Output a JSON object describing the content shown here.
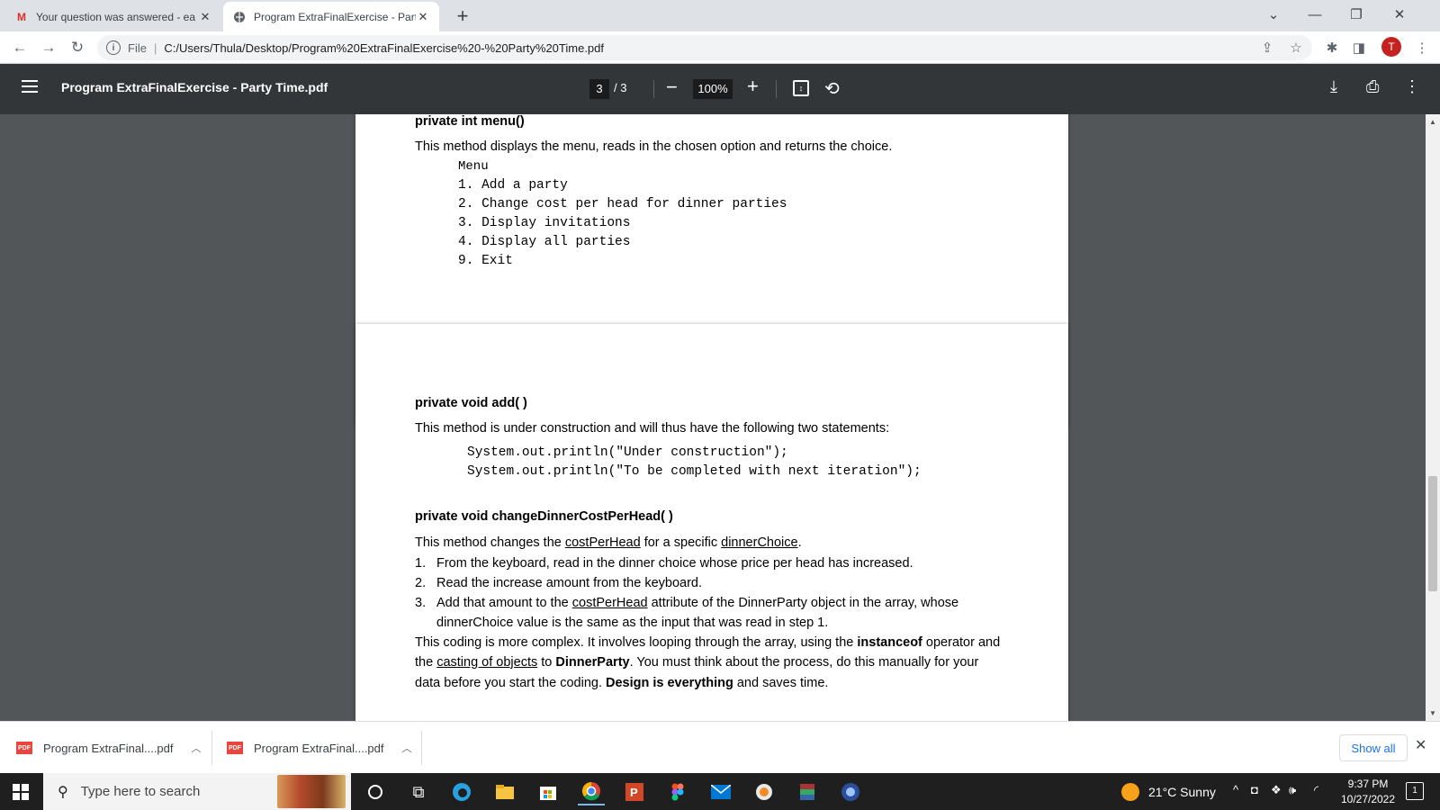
{
  "browser": {
    "tabs": [
      {
        "title": "Your question was answered - ea",
        "favicon": "gmail-icon"
      },
      {
        "title": "Program ExtraFinalExercise - Part",
        "favicon": "globe-icon"
      }
    ],
    "file_label": "File",
    "url": "C:/Users/Thula/Desktop/Program%20ExtraFinalExercise%20-%20Party%20Time.pdf",
    "profile_initial": "T"
  },
  "pdf_toolbar": {
    "title": "Program ExtraFinalExercise - Party Time.pdf",
    "current_page": "3",
    "page_sep_total": "/  3",
    "zoom": "100%"
  },
  "document": {
    "page1": {
      "heading": "private int menu()",
      "intro": "This method displays the menu, reads in the chosen option and returns the choice.",
      "menu_lines": [
        "Menu",
        "1. Add a party",
        "2. Change cost per head for dinner parties",
        "3. Display invitations",
        "4. Display all parties",
        "9. Exit"
      ]
    },
    "page2": {
      "add_heading": "private void add( )",
      "add_intro": "This method is under construction and will thus have the following two statements:",
      "code_lines": [
        "System.out.println(\"Under construction\");",
        "System.out.println(\"To be completed with next iteration\");"
      ],
      "change_heading": "private void changeDinnerCostPerHead( )",
      "change_intro_a": "This method changes the ",
      "change_intro_link1": "costPerHead",
      "change_intro_b": " for a specific ",
      "change_intro_link2": "dinnerChoice",
      "change_intro_c": ".",
      "steps": [
        {
          "num": "1.",
          "text": "From the keyboard, read in the dinner choice whose price per head has increased."
        },
        {
          "num": "2.",
          "text": "Read the increase amount from the keyboard."
        },
        {
          "num": "3.",
          "text_a": "Add that amount to the ",
          "text_link": "costPerHead",
          "text_b": " attribute of the DinnerParty object in the array, whose",
          "text_line2": "dinnerChoice value is the same as the input that was read in step 1."
        }
      ],
      "para_l1_a": "This coding is more complex.  It involves looping through the array, using the ",
      "para_l1_bold": "instanceof",
      "para_l1_b": " operator and",
      "para_l2_a": "the ",
      "para_l2_link": "casting of objects",
      "para_l2_b": " to ",
      "para_l2_bold": "DinnerParty",
      "para_l2_c": ".  You must think about the process, do this manually for your",
      "para_l3_a": "data before you start the coding.  ",
      "para_l3_bold": "Design is everything",
      "para_l3_b": " and saves time."
    }
  },
  "downloads": {
    "items": [
      "Program ExtraFinal....pdf",
      "Program ExtraFinal....pdf"
    ],
    "pdf_badge": "PDF",
    "show_all": "Show all"
  },
  "taskbar": {
    "search_placeholder": "Type here to search",
    "weather": "21°C  Sunny",
    "time": "9:37 PM",
    "date": "10/27/2022",
    "notification_count": "1"
  }
}
